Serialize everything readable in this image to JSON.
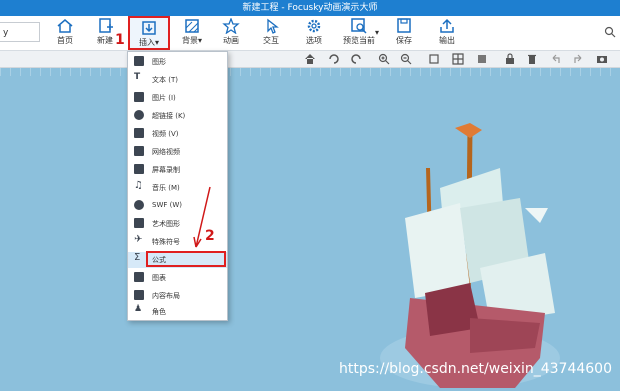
{
  "window": {
    "title": "新建工程 - Focusky动画演示大师"
  },
  "left_field": {
    "value": "y"
  },
  "ribbon": [
    {
      "name": "home",
      "label": "首页"
    },
    {
      "name": "new",
      "label": "新建"
    },
    {
      "name": "insert",
      "label": "插入"
    },
    {
      "name": "background",
      "label": "背景"
    },
    {
      "name": "animation",
      "label": "动画"
    },
    {
      "name": "interact",
      "label": "交互"
    },
    {
      "name": "options",
      "label": "选项"
    },
    {
      "name": "preview",
      "label": "预览当前"
    },
    {
      "name": "save",
      "label": "保存"
    },
    {
      "name": "export",
      "label": "输出"
    }
  ],
  "insert_menu": [
    {
      "label": "图形",
      "icon": "shape-icon"
    },
    {
      "label": "文本 (T)",
      "icon": "text-icon"
    },
    {
      "label": "图片 (I)",
      "icon": "image-icon"
    },
    {
      "label": "超链接 (K)",
      "icon": "link-icon"
    },
    {
      "label": "视频 (V)",
      "icon": "video-icon"
    },
    {
      "label": "网络视频",
      "icon": "web-video-icon"
    },
    {
      "label": "屏幕录制",
      "icon": "screen-record-icon"
    },
    {
      "label": "音乐 (M)",
      "icon": "music-icon"
    },
    {
      "label": "SWF (W)",
      "icon": "swf-icon"
    },
    {
      "label": "艺术图形",
      "icon": "art-shape-icon"
    },
    {
      "label": "特殊符号",
      "icon": "special-symbol-icon"
    },
    {
      "label": "公式",
      "icon": "formula-icon"
    },
    {
      "label": "图表",
      "icon": "chart-icon"
    },
    {
      "label": "内容布局",
      "icon": "layout-icon"
    },
    {
      "label": "角色",
      "icon": "role-icon"
    }
  ],
  "annotations": {
    "step1": "1",
    "step2": "2"
  },
  "watermark": "https://blog.csdn.net/weixin_43744600",
  "colors": {
    "title_bar": "#1e7fd0",
    "highlight": "#e02020",
    "canvas": "#8cc0dc"
  }
}
